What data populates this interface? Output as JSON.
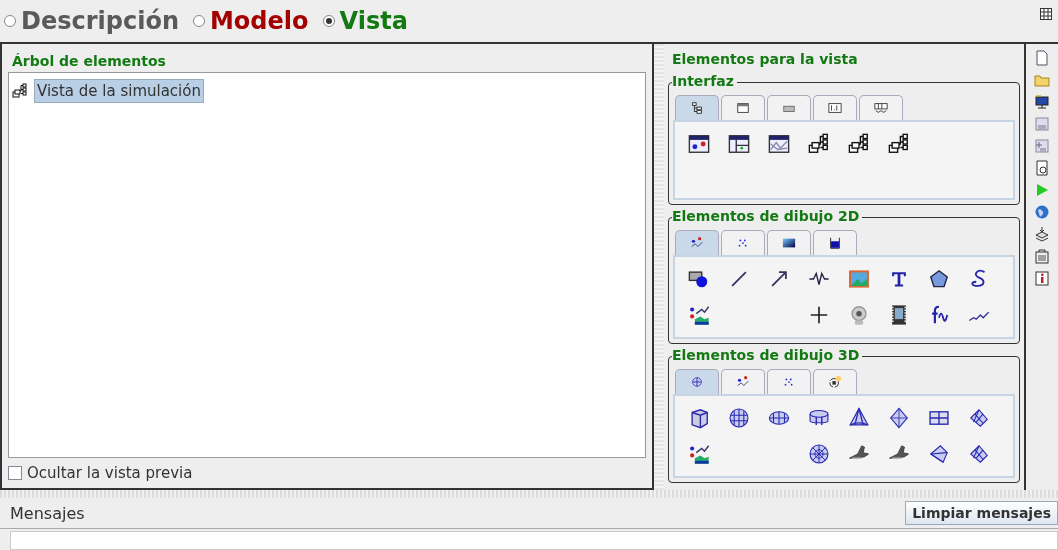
{
  "modes": [
    {
      "label": "Descripción",
      "kind": "description",
      "selected": false
    },
    {
      "label": "Modelo",
      "kind": "model",
      "selected": false
    },
    {
      "label": "Vista",
      "kind": "view",
      "selected": true
    }
  ],
  "tree_panel": {
    "title": "Árbol de elementos",
    "items": [
      {
        "label": "Vista de la simulación",
        "selected": true
      }
    ],
    "hide_preview": {
      "label": "Ocultar la vista previa",
      "checked": false
    }
  },
  "palette": {
    "title": "Elementos para la vista",
    "groups": [
      {
        "title": "Interfaz",
        "tabs": [
          {
            "kind": "tree",
            "selected": true
          },
          {
            "kind": "window",
            "selected": false
          },
          {
            "kind": "button",
            "selected": false
          },
          {
            "kind": "number",
            "selected": false
          },
          {
            "kind": "table",
            "selected": false
          }
        ],
        "rows": [
          [
            {
              "kind": "frame"
            },
            {
              "kind": "dialog"
            },
            {
              "kind": "plotframe"
            },
            {
              "kind": "group"
            },
            {
              "kind": "group"
            },
            {
              "kind": "group"
            }
          ]
        ]
      },
      {
        "title": "Elementos de dibujo 2D",
        "tabs": [
          {
            "kind": "scatter",
            "selected": true
          },
          {
            "kind": "dots",
            "selected": false
          },
          {
            "kind": "gradient",
            "selected": false
          },
          {
            "kind": "tank",
            "selected": false
          }
        ],
        "rows": [
          [
            {
              "kind": "shape"
            },
            {
              "kind": "segment"
            },
            {
              "kind": "arrow"
            },
            {
              "kind": "spring"
            },
            {
              "kind": "image"
            },
            {
              "kind": "text"
            },
            {
              "kind": "polygon"
            },
            {
              "kind": "curve"
            }
          ],
          [
            {
              "kind": "scene"
            },
            {
              "kind": "cross"
            },
            {
              "kind": "webcam"
            },
            {
              "kind": "video"
            },
            {
              "kind": "function"
            },
            {
              "kind": "trail"
            }
          ]
        ]
      },
      {
        "title": "Elementos de dibujo 3D",
        "tabs": [
          {
            "kind": "mesh",
            "selected": true
          },
          {
            "kind": "scatter",
            "selected": false
          },
          {
            "kind": "dots",
            "selected": false
          },
          {
            "kind": "rotate",
            "selected": false
          }
        ],
        "rows": [
          [
            {
              "kind": "cube"
            },
            {
              "kind": "sphere"
            },
            {
              "kind": "ellipsoid"
            },
            {
              "kind": "cylinder"
            },
            {
              "kind": "cone"
            },
            {
              "kind": "diamond"
            },
            {
              "kind": "plane"
            },
            {
              "kind": "surface"
            }
          ],
          [
            {
              "kind": "scene"
            },
            {
              "kind": "wiresphere"
            },
            {
              "kind": "shuttle"
            },
            {
              "kind": "shuttle"
            },
            {
              "kind": "polygon3d"
            },
            {
              "kind": "surface"
            }
          ]
        ]
      }
    ]
  },
  "messages": {
    "title": "Mensajes",
    "clear_button": "Limpiar mensajes"
  }
}
